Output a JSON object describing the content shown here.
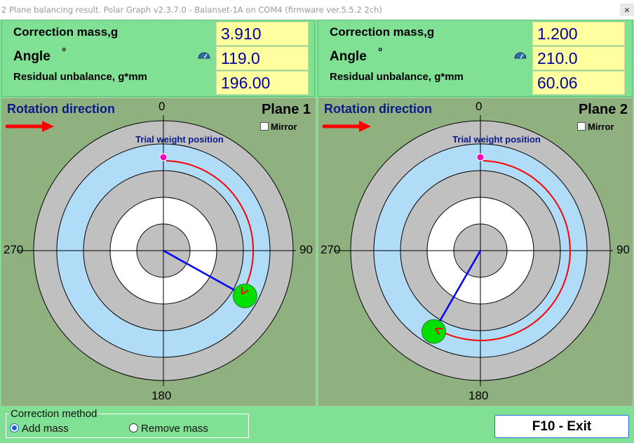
{
  "window": {
    "title": "2 Plane balancing result. Polar Graph v2.3.7.0 - Balanset-1A on COM4 (firmware ver.5.5.2 2ch)",
    "close_glyph": "×"
  },
  "labels": {
    "correction_mass": "Correction mass,g",
    "angle": "Angle",
    "degree_symbol": "°",
    "residual_unbalance": "Residual unbalance, g*mm",
    "rotation_direction": "Rotation direction",
    "mirror": "Mirror",
    "trial_weight_position": "Trial weight position"
  },
  "planes": [
    {
      "name": "Plane 1",
      "correction_mass": "3.910",
      "angle": "119.0",
      "residual_unbalance": "196.00",
      "angle_deg": 119.0,
      "mirror_checked": false
    },
    {
      "name": "Plane 2",
      "correction_mass": "1.200",
      "angle": "210.0",
      "residual_unbalance": "60.06",
      "angle_deg": 210.0,
      "mirror_checked": false
    }
  ],
  "axis_labels": {
    "top": "0",
    "right": "90",
    "bottom": "180",
    "left": "270"
  },
  "correction_method": {
    "legend": "Correction method",
    "options": [
      "Add mass",
      "Remove mass"
    ],
    "selected": "Add mass"
  },
  "exit_button": "F10 - Exit",
  "colors": {
    "window_bg": "#80e094",
    "plot_bg": "#8fb07f",
    "value_bg": "#ffffa0",
    "value_text": "#0000a0",
    "ring_gray": "#c0c0c0",
    "ring_blue": "#b0dcf8",
    "ring_white": "#ffffff",
    "vector": "#0000ff",
    "arc": "#ff0000",
    "weight": "#00e000",
    "trial_marker": "#ff00c0"
  },
  "icons": {
    "gauge": "gauge-icon",
    "rotation_arrow": "red-arrow-right-icon",
    "close": "close-icon"
  }
}
